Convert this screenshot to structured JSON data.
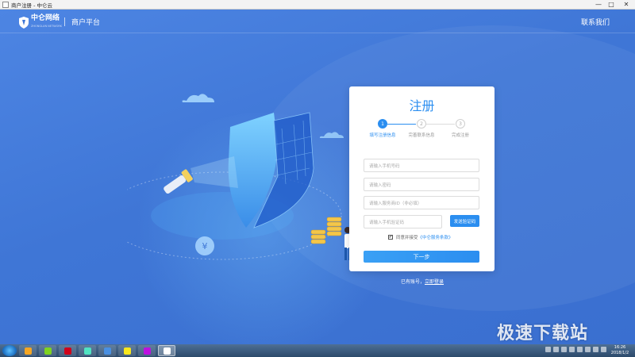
{
  "window": {
    "title": "商户注册 - 中仑云",
    "minimize": "—",
    "maximize": "□",
    "close": "✕"
  },
  "header": {
    "logo_text": "中仑网络",
    "logo_sub": "ZHONGLUN NETWORK",
    "platform": "商户平台",
    "contact": "联系我们"
  },
  "card": {
    "title": "注册",
    "steps": [
      {
        "number": "1",
        "label": "填写注册信息",
        "active": true
      },
      {
        "number": "2",
        "label": "完善联系信息",
        "active": false
      },
      {
        "number": "3",
        "label": "完成注册",
        "active": false
      }
    ],
    "fields": {
      "phone_placeholder": "请输入手机号码",
      "password_placeholder": "请输入密码",
      "provider_placeholder": "请输入服务商ID（非必填）",
      "code_placeholder": "请输入手机验证码"
    },
    "code_button": "发送验证码",
    "agree_checkbox": "✔",
    "agree_text": "同意并接受",
    "agree_link": "《中仑服务条款》",
    "next_button": "下一步"
  },
  "login_hint": {
    "text": "已有账号，",
    "link": "立即登录"
  },
  "watermark": "极速下载站",
  "taskbar": {
    "clock_time": "16:26",
    "clock_date": "2018/1/2"
  },
  "colors": {
    "accent": "#2b8ef0",
    "background": "#3f77d6"
  }
}
